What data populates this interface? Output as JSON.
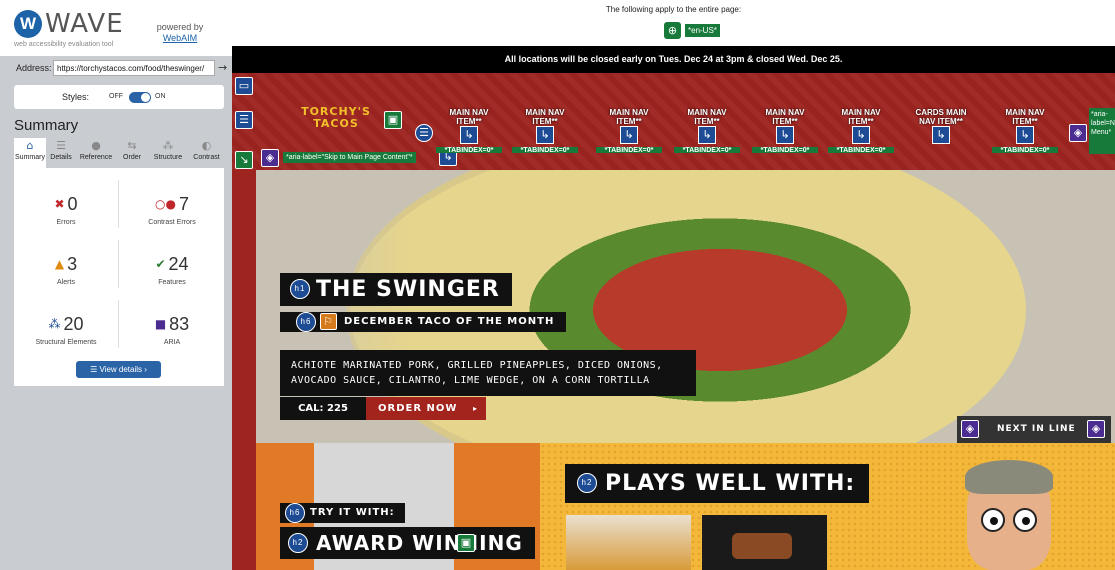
{
  "wave": {
    "name": "WAVE",
    "logo_letter": "W",
    "tagline": "web accessibility evaluation tool",
    "powered_by": "powered by",
    "powered_link": "WebAIM"
  },
  "address": {
    "label": "Address:",
    "value": "https://torchystacos.com/food/theswinger/",
    "go_icon": "arrow-right-icon"
  },
  "styles": {
    "label": "Styles:",
    "off": "OFF",
    "on": "ON",
    "state": "on"
  },
  "summary": {
    "heading": "Summary",
    "tabs": [
      {
        "label": "Summary",
        "icon": "home-icon"
      },
      {
        "label": "Details",
        "icon": "list-icon"
      },
      {
        "label": "Reference",
        "icon": "info-icon"
      },
      {
        "label": "Order",
        "icon": "order-icon"
      },
      {
        "label": "Structure",
        "icon": "structure-icon"
      },
      {
        "label": "Contrast",
        "icon": "contrast-icon"
      }
    ],
    "stats": {
      "errors": {
        "count": "0",
        "label": "Errors"
      },
      "contrast": {
        "count": "7",
        "label": "Contrast Errors"
      },
      "alerts": {
        "count": "3",
        "label": "Alerts"
      },
      "features": {
        "count": "24",
        "label": "Features"
      },
      "structural": {
        "count": "20",
        "label": "Structural Elements"
      },
      "aria": {
        "count": "83",
        "label": "ARIA"
      }
    },
    "view_details": "View details ›"
  },
  "page": {
    "lang_note": "The following apply to the entire page:",
    "lang_tag": "*en-US*",
    "banner": "All locations will be closed early on Tues. Dec 24 at 3pm & closed Wed. Dec 25.",
    "logo_text_1": "TORCHY'S",
    "logo_text_2": "TACOS",
    "nav_items": [
      {
        "label": "MAIN NAV ITEM**",
        "tag": "*TABINDEX=0*"
      },
      {
        "label": "MAIN NAV ITEM**",
        "tag": "*TABINDEX=0*"
      },
      {
        "label": "MAIN NAV ITEM**",
        "tag": "*TABINDEX=0*"
      },
      {
        "label": "MAIN NAV ITEM**",
        "tag": "*TABINDEX=0*"
      },
      {
        "label": "MAIN NAV ITEM**",
        "tag": "*TABINDEX=0*"
      },
      {
        "label": "MAIN NAV ITEM**",
        "tag": "*TABINDEX=0*"
      },
      {
        "label": "CARDS MAIN NAV ITEM**",
        "tag": ""
      },
      {
        "label": "MAIN NAV ITEM**",
        "tag": "*TABINDEX=0*"
      }
    ],
    "skip_tag": "*aria-label=\"Skip to Main Page Content\"*",
    "tabindex_small": "*tabindex=0*",
    "aria_side": "*aria-label=Navig Menu*",
    "hero": {
      "title": "THE SWINGER",
      "h1": "h1",
      "subtitle": "DECEMBER TACO OF THE MONTH",
      "h6": "h6",
      "description": "ACHIOTE MARINATED PORK, GRILLED PINEAPPLES, DICED ONIONS, AVOCADO SAUCE, CILANTRO, LIME WEDGE, ON A CORN TORTILLA",
      "calories": "CAL: 225",
      "order": "ORDER NOW",
      "order_arrow": "▸",
      "next": "NEXT IN LINE"
    },
    "lower": {
      "try_it": "TRY IT WITH:",
      "award": "AWARD WINNING",
      "plays": "PLAYS WELL WITH:",
      "h2": "h2"
    }
  }
}
